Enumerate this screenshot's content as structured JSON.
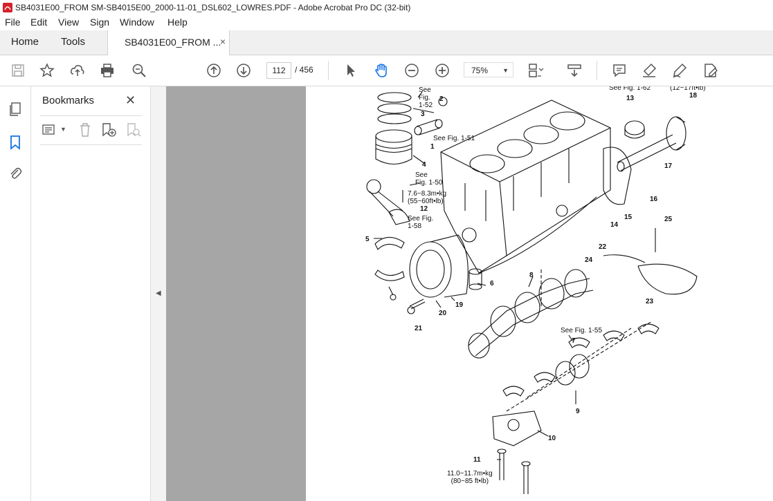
{
  "window": {
    "title": "SB4031E00_FROM SM-SB4015E00_2000-11-01_DSL602_LOWRES.PDF - Adobe Acrobat Pro DC (32-bit)"
  },
  "menu": [
    "File",
    "Edit",
    "View",
    "Sign",
    "Window",
    "Help"
  ],
  "tabs": {
    "home": "Home",
    "tools": "Tools",
    "document": "SB4031E00_FROM ...",
    "close": "×"
  },
  "toolbar": {
    "current_page": "112",
    "page_total": "/ 456",
    "zoom": "75%",
    "icons": [
      "save-icon",
      "bookmark-star-icon",
      "upload-icon",
      "print-icon",
      "zoom-search-icon",
      "page-up-icon",
      "page-down-icon",
      "select-pointer-icon",
      "hand-tool-icon",
      "zoom-out-icon",
      "zoom-in-icon",
      "page-layout-icon",
      "scroll-mode-icon",
      "comment-icon",
      "highlight-icon",
      "draw-icon",
      "fill-sign-icon"
    ]
  },
  "bookmarks_panel": {
    "title": "Bookmarks",
    "close": "✕"
  },
  "figure": {
    "callouts": {
      "see_fig_52": "See\nFig.\n1-52",
      "n2": "2",
      "n3": "3",
      "see_fig_51": "See Fig. 1-51",
      "n1": "1",
      "n4": "4",
      "see_fig_50": "See\nFig. 1-50",
      "torque_12": "7.6~8.3m•kg\n(55~60ft•lb)",
      "n12": "12",
      "see_fig_58": "See Fig.\n1-58",
      "n5": "5",
      "n6": "6",
      "n19": "19",
      "n20": "20",
      "n21": "21",
      "n8": "8",
      "see_fig_62": "See Fig. 1-62",
      "torque_18": "(12~17ft•lb)",
      "n13": "13",
      "n18": "18",
      "n17": "17",
      "n16": "16",
      "n14": "14",
      "n15": "15",
      "n25": "25",
      "n22": "22",
      "n24": "24",
      "n23": "23",
      "see_fig_55": "See Fig. 1-55",
      "n7": "7",
      "n9": "9",
      "n10": "10",
      "n11": "11",
      "torque_11": "11.0~11.7m•kg\n(80~85 ft•lb)"
    }
  },
  "colors": {
    "acrobat_red": "#d4222a",
    "canvas_gray": "#a6a6a6",
    "accent_blue": "#1473e6"
  }
}
